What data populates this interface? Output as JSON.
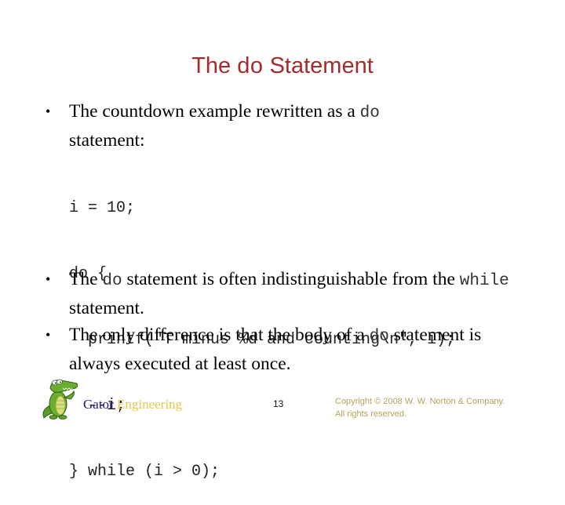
{
  "slide": {
    "title_prefix": "The ",
    "title_keyword": "do",
    "title_suffix": " Statement",
    "colors": {
      "title": "#a52a2a",
      "gator": "#1c1c7a",
      "engineering": "#e8c84a",
      "copyright": "#b8a15a"
    }
  },
  "bullets": [
    {
      "marker": "•",
      "line1_text": "The countdown example rewritten as a ",
      "line1_code": "do",
      "line2_text": "statement:"
    },
    {
      "marker": "•",
      "text1": "The ",
      "code1": "do",
      "text2": " statement is often indistinguishable from the ",
      "code2": "while",
      "text3": " statement."
    },
    {
      "marker": "•",
      "text1": "The only difference is that the body of a ",
      "code1": "do",
      "text2": " statement is always executed at least once."
    }
  ],
  "code": {
    "lines": [
      "i = 10;",
      "do {",
      "  printf(\"T minus %d and counting\\n\", i);",
      "  --i;",
      "} while (i > 0);"
    ]
  },
  "footer": {
    "logo_icon": "gator-mascot-icon",
    "brand_gator": "Gator",
    "brand_engineering": "Engineering",
    "page_number": "13",
    "copyright_line1": "Copyright © 2008 W. W. Norton & Company.",
    "copyright_line2": "All rights reserved."
  }
}
